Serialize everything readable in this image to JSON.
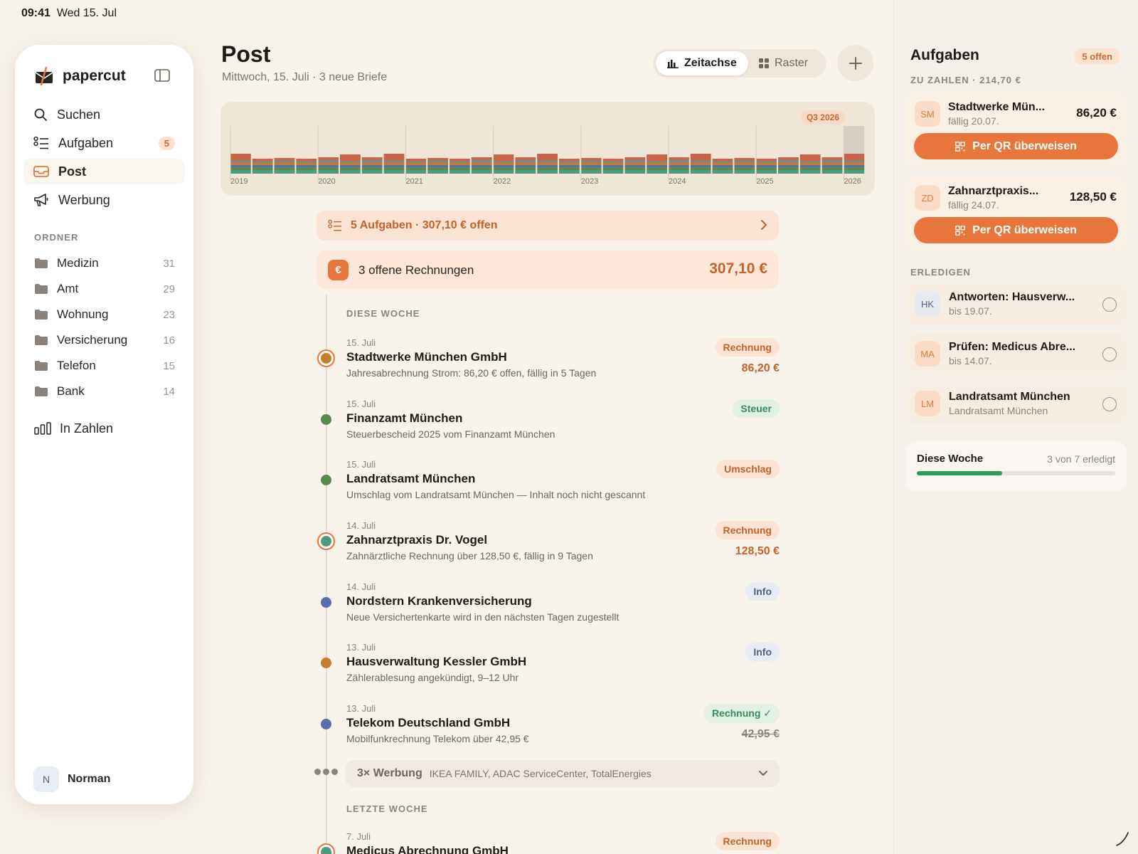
{
  "status": {
    "time": "09:41",
    "date": "Wed 15. Jul"
  },
  "sidebar": {
    "brand": "papercut",
    "nav": [
      {
        "label": "Suchen",
        "icon": "search-icon"
      },
      {
        "label": "Aufgaben",
        "icon": "tasks-icon",
        "badge": "5"
      },
      {
        "label": "Post",
        "icon": "inbox-icon",
        "active": true
      },
      {
        "label": "Werbung",
        "icon": "megaphone-icon"
      }
    ],
    "folders_label": "ORDNER",
    "folders": [
      {
        "name": "Medizin",
        "count": "31"
      },
      {
        "name": "Amt",
        "count": "29"
      },
      {
        "name": "Wohnung",
        "count": "23"
      },
      {
        "name": "Versicherung",
        "count": "16"
      },
      {
        "name": "Telefon",
        "count": "15"
      },
      {
        "name": "Bank",
        "count": "14"
      }
    ],
    "stats_label": "In Zahlen",
    "user": {
      "initial": "N",
      "name": "Norman"
    }
  },
  "main": {
    "title": "Post",
    "subtitle": "Mittwoch, 15. Juli · 3 neue Briefe",
    "view_toggle": {
      "timeline": "Zeitachse",
      "grid": "Raster",
      "active": "timeline"
    },
    "timeline": {
      "badge": "Q3 2026",
      "years": [
        "2019",
        "2020",
        "2021",
        "2022",
        "2023",
        "2024",
        "2025",
        "2026"
      ],
      "colors": [
        "#4f9a7e",
        "#5a8a4e",
        "#5a6fae",
        "#c77a2f",
        "#8a827a",
        "#c96248"
      ]
    },
    "task_banner": "5 Aufgaben · 307,10 € offen",
    "invoices": {
      "label": "3 offene Rechnungen",
      "total": "307,10 €"
    },
    "this_week_label": "DIESE WOCHE",
    "last_week_label": "LETZTE WOCHE",
    "entries": [
      {
        "date": "15. Juli",
        "title": "Stadtwerke München GmbH",
        "desc": "Jahresabrechnung Strom: 86,20 € offen, fällig in 5 Tagen",
        "tag": "Rechnung",
        "tag_type": "rechnung",
        "amount": "86,20 €",
        "dot": "#c47f2e",
        "ring": true
      },
      {
        "date": "15. Juli",
        "title": "Finanzamt München",
        "desc": "Steuerbescheid 2025 vom Finanzamt München",
        "tag": "Steuer",
        "tag_type": "steuer",
        "dot": "#5a8a4e"
      },
      {
        "date": "15. Juli",
        "title": "Landratsamt München",
        "desc": "Umschlag vom Landratsamt München — Inhalt noch nicht gescannt",
        "tag": "Umschlag",
        "tag_type": "umschlag",
        "dot": "#5a8a4e"
      },
      {
        "date": "14. Juli",
        "title": "Zahnarztpraxis Dr. Vogel",
        "desc": "Zahnärztliche Rechnung über 128,50 €, fällig in 9 Tagen",
        "tag": "Rechnung",
        "tag_type": "rechnung",
        "amount": "128,50 €",
        "dot": "#4f9a7e",
        "ring": true
      },
      {
        "date": "14. Juli",
        "title": "Nordstern Krankenversicherung",
        "desc": "Neue Versichertenkarte wird in den nächsten Tagen zugestellt",
        "tag": "Info",
        "tag_type": "info",
        "dot": "#5a6fae"
      },
      {
        "date": "13. Juli",
        "title": "Hausverwaltung Kessler GmbH",
        "desc": "Zählerablesung angekündigt, 9–12 Uhr",
        "tag": "Info",
        "tag_type": "info",
        "dot": "#c47f2e"
      },
      {
        "date": "13. Juli",
        "title": "Telekom Deutschland GmbH",
        "desc": "Mobilfunkrechnung Telekom über 42,95 €",
        "tag": "Rechnung ✓",
        "tag_type": "paid",
        "amount": "42,95 €",
        "amount_struck": true,
        "dot": "#5a6fae"
      }
    ],
    "werbung": {
      "count": "3× Werbung",
      "names": "IKEA FAMILY, ADAC ServiceCenter, TotalEnergies"
    },
    "last_week_entries": [
      {
        "date": "7. Juli",
        "title": "Medicus Abrechnung GmbH",
        "tag": "Rechnung",
        "tag_type": "rechnung",
        "dot": "#4f9a7e",
        "ring": true
      }
    ]
  },
  "tasks": {
    "title": "Aufgaben",
    "badge": "5 offen",
    "pay_label": "ZU ZAHLEN · 214,70 €",
    "pay": [
      {
        "initials": "SM",
        "name": "Stadtwerke Mün...",
        "due": "fällig 20.07.",
        "amount": "86,20 €",
        "button": "Per QR überweisen"
      },
      {
        "initials": "ZD",
        "name": "Zahnarztpraxis...",
        "due": "fällig 24.07.",
        "amount": "128,50 €",
        "button": "Per QR überweisen"
      }
    ],
    "todo_label": "ERLEDIGEN",
    "todos": [
      {
        "initials": "HK",
        "title": "Antworten: Hausverw...",
        "sub": "bis 19.07.",
        "bg": "#e6e9ee",
        "fg": "#56627a"
      },
      {
        "initials": "MA",
        "title": "Prüfen: Medicus Abre...",
        "sub": "bis 14.07.",
        "bg": "#f8dcc8",
        "fg": "#e07a3f"
      },
      {
        "initials": "LM",
        "title": "Landratsamt München",
        "sub": "Landratsamt München",
        "bg": "#f8dcc8",
        "fg": "#e07a3f"
      }
    ],
    "week": {
      "title": "Diese Woche",
      "count": "3 von 7 erledigt",
      "done": 3,
      "total": 7
    }
  }
}
